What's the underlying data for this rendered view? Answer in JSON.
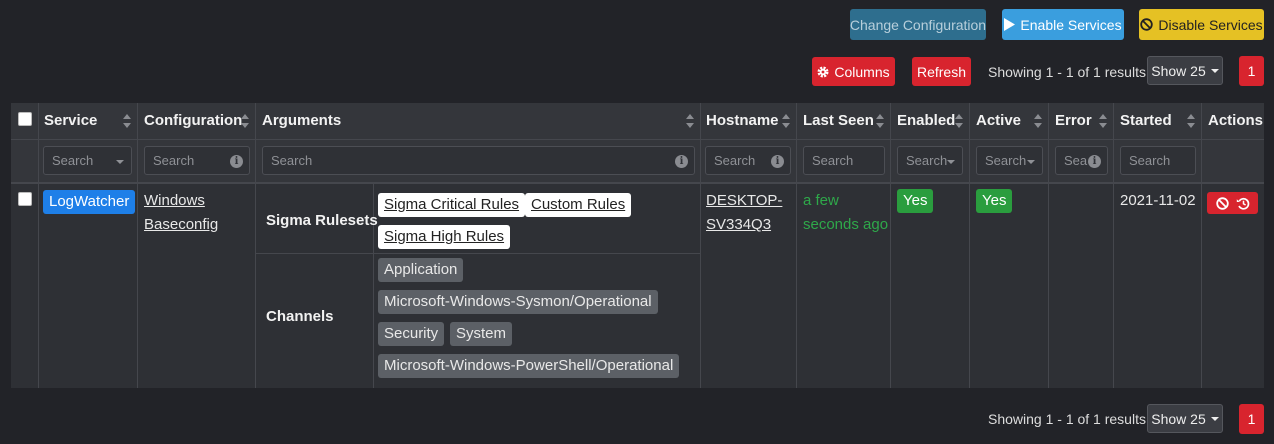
{
  "toolbar": {
    "change_configuration": "Change Configuration",
    "enable_services": "Enable Services",
    "disable_services": "Disable Services",
    "columns": "Columns",
    "refresh": "Refresh"
  },
  "pagination": {
    "showing": "Showing 1 - 1 of 1 results",
    "show": "Show 25",
    "page": "1"
  },
  "table": {
    "headers": [
      "Service",
      "Configuration",
      "Arguments",
      "Hostname",
      "Last Seen",
      "Enabled",
      "Active",
      "Error",
      "Started",
      "Actions"
    ],
    "filters": {
      "service_placeholder": "Search",
      "configuration_placeholder": "Search",
      "arguments_placeholder": "Search",
      "hostname_placeholder": "Search",
      "last_seen_placeholder": "Search",
      "enabled_placeholder": "Search",
      "active_placeholder": "Search",
      "error_placeholder": "Sea",
      "started_placeholder": "Search"
    },
    "row": {
      "service": "LogWatcher",
      "configuration_line1": "Windows",
      "configuration_line2": "Baseconfig",
      "arguments": {
        "sigma_label": "Sigma Rulesets",
        "sigma": [
          "Sigma Critical Rules",
          "Custom Rules",
          "Sigma High Rules"
        ],
        "channels_label": "Channels",
        "channels": [
          "Application",
          "Microsoft-Windows-Sysmon/Operational",
          "Security",
          "System",
          "Microsoft-Windows-PowerShell/Operational"
        ]
      },
      "hostname_line1": "DESKTOP-",
      "hostname_line2": "SV334Q3",
      "last_seen_line1": "a few",
      "last_seen_line2": "seconds ago",
      "enabled": "Yes",
      "active": "Yes",
      "error": "",
      "started": "2021-11-02"
    }
  },
  "colors": {
    "background": "#222328",
    "table_bg": "#2e3035",
    "danger": "#d8242e",
    "primary": "#1e7fe8",
    "success": "#2a9d3e",
    "warning": "#e5c124",
    "info": "#3a9ede"
  },
  "icons": {
    "columns": "gear-icon",
    "enable": "play-icon",
    "disable": "ban-icon",
    "row_disable": "ban-icon",
    "row_restart": "history-icon"
  }
}
